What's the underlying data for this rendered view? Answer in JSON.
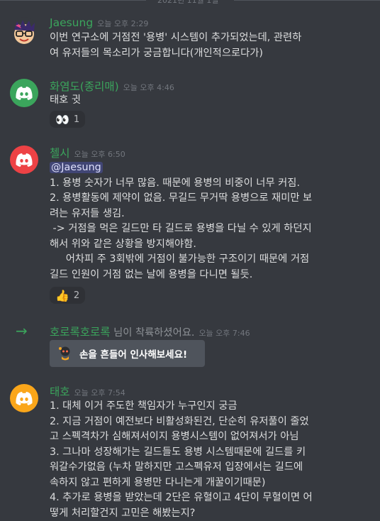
{
  "date_divider": "2021년 11월 1일",
  "messages": [
    {
      "username": "Jaesung",
      "username_color": "#3ba55c",
      "timestamp": "오늘 오후 2:29",
      "lines": [
        "이번 연구소에 거점전 '용병' 시스템이 추가되었는데, 관련하",
        "여 유저들의 목소리가 궁금합니다(개인적으로다가)"
      ]
    },
    {
      "username": "화염도(종리매)",
      "username_color": "#3ba55c",
      "timestamp": "오늘 오후 4:46",
      "avatar_color": "#3ba55c",
      "lines": [
        "태호 귓"
      ],
      "reaction": {
        "emoji": "👀",
        "count": "1"
      }
    },
    {
      "username": "첼시",
      "username_color": "#3ba55c",
      "timestamp": "오늘 오후 6:50",
      "avatar_color": "#ed4245",
      "mention": "@Jaesung",
      "lines": [
        "1. 용병 숫자가 너무 많음. 때문에 용병의 비중이 너무 커짐.",
        "2. 용병활동에 제약이 없음. 무길드 무거딱 용병으로 재미만 보",
        "려는 유저들 생김.",
        " -> 거점을 먹은 길드만 타 길드로 용병을 다닐 수 있게 하던지",
        "해서 위와 같은 상황을 방지해야함.",
        "     어차피 주 3회밖에 거점이 불가능한 구조이기 때문에 거점",
        "길드 인원이 거점 없는 날에 용병을 다니면 될듯."
      ],
      "reaction": {
        "emoji": "👍",
        "count": "2"
      }
    },
    {
      "system_user": "호로록호로록",
      "system_text": "님이 착륙하셨어요.",
      "timestamp": "오늘 오후 7:46",
      "wave_button": "손을 흔들어 인사해보세요!"
    },
    {
      "username": "태호",
      "username_color": "#3ba55c",
      "timestamp": "오늘 오후 7:54",
      "avatar_color": "#faa61a",
      "lines": [
        "1. 대체 이거 주도한 책임자가 누구인지 궁금",
        "2. 지금 거점이 예전보다 비활성화된건, 단순히 유저풀이 줄었",
        "고 스펙격차가 심해져서이지 용병시스템이 없어져서가 아님",
        "3. 그나마 성장해가는 길드들도 용병 시스템때문에 길드를 키",
        "워갈수가없음 (누차 말하지만 고스펙유저 입장에서는 길드에",
        "속하지 않고 편하게 용병만 다니는게 개꿀이기때문)",
        "4. 추가로 용병을 받았는데 2단은 유혈이고 4단이 무혈이면 어",
        "떻게 처리할건지 고민은 해봤는지?"
      ]
    }
  ]
}
